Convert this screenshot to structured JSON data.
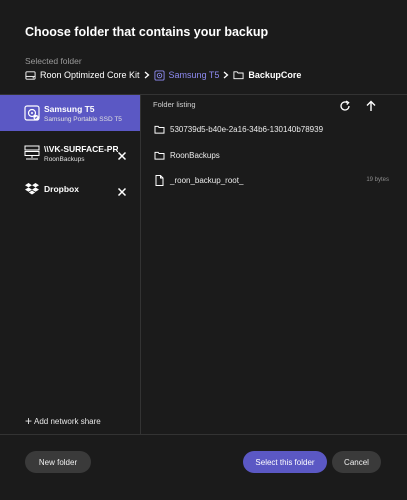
{
  "dialog": {
    "title": "Choose folder that contains your backup",
    "selected_label": "Selected folder"
  },
  "breadcrumb": [
    {
      "label": "Roon Optimized Core Kit",
      "icon": "drive-icon"
    },
    {
      "label": "Samsung T5",
      "icon": "disk-icon",
      "accent": "#8d8af0"
    },
    {
      "label": "BackupCore",
      "icon": "folder-icon"
    }
  ],
  "sources": [
    {
      "name": "Samsung T5",
      "sub": "Samsung Portable SSD T5",
      "icon": "disk-icon",
      "active": true,
      "removable": false
    },
    {
      "name": "\\\\VK-SURFACE-PRO",
      "sub": "RoonBackups",
      "icon": "network-server-icon",
      "active": false,
      "removable": true
    },
    {
      "name": "Dropbox",
      "sub": "",
      "icon": "dropbox-icon",
      "active": false,
      "removable": true
    }
  ],
  "add_network_share": "Add network share",
  "listing": {
    "header": "Folder listing",
    "items": [
      {
        "name": "530739d5-b40e-2a16-34b6-130140b78939",
        "type": "folder",
        "size": ""
      },
      {
        "name": "RoonBackups",
        "type": "folder",
        "size": ""
      },
      {
        "name": "_roon_backup_root_",
        "type": "file",
        "size": "19 bytes"
      }
    ]
  },
  "buttons": {
    "new_folder": "New folder",
    "select": "Select this folder",
    "cancel": "Cancel"
  },
  "colors": {
    "accent": "#5b58c4",
    "background": "#1b1b1b"
  }
}
